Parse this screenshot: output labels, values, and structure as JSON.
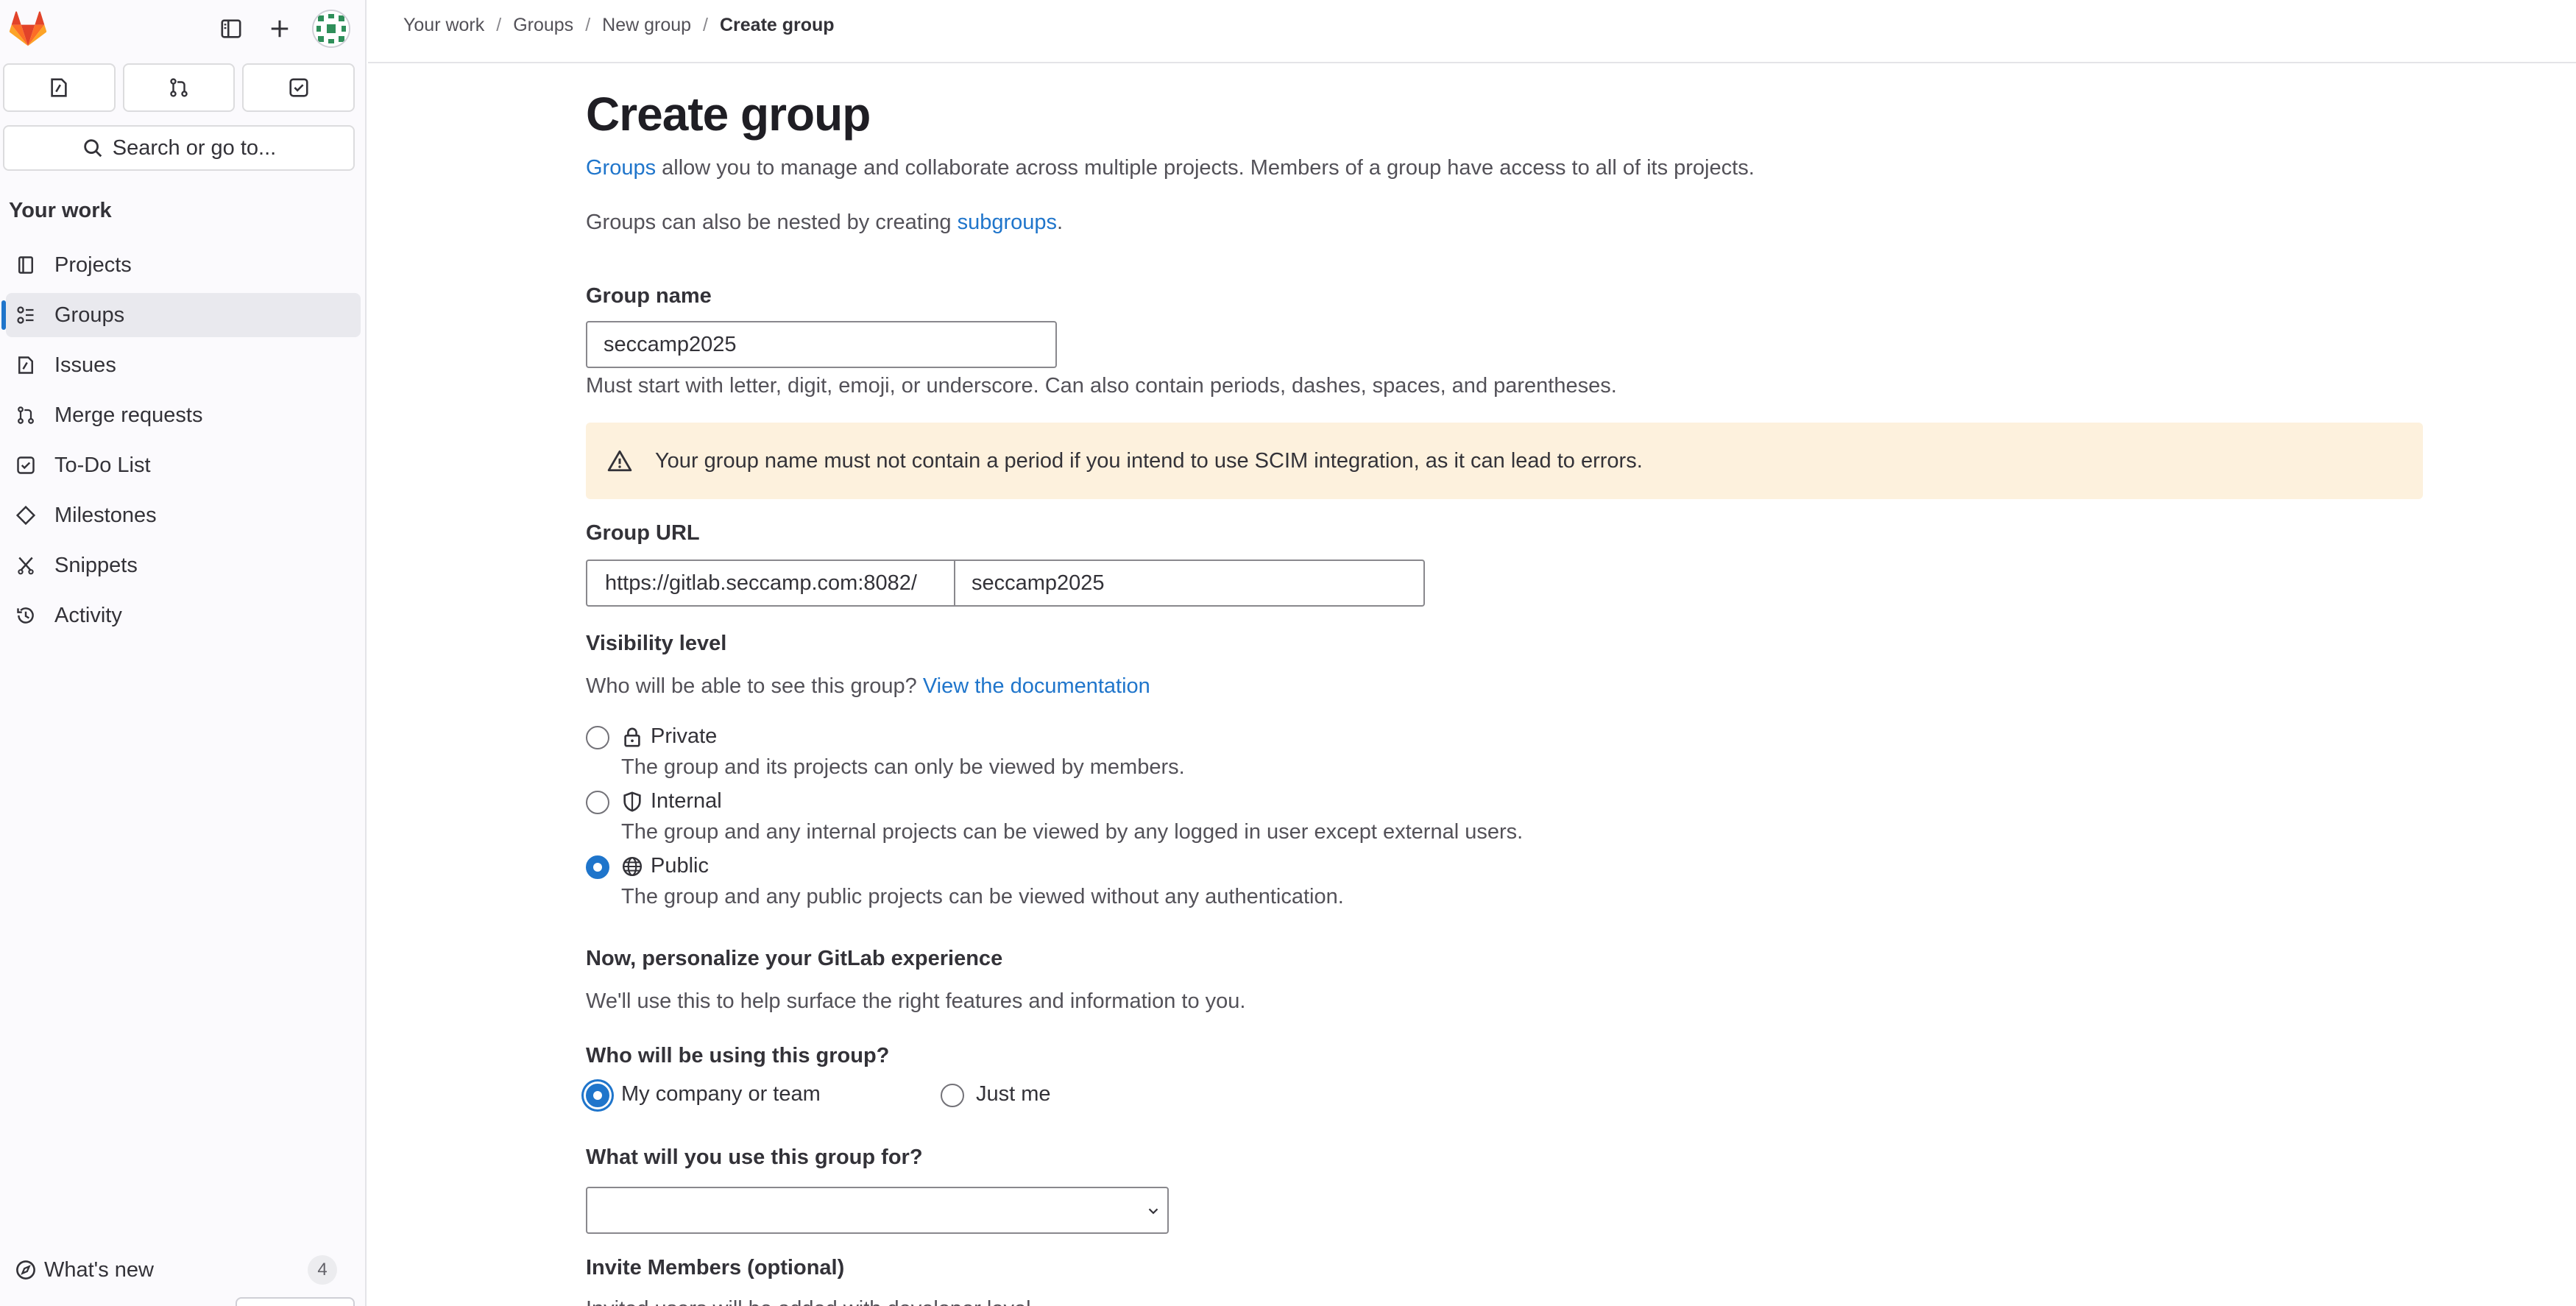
{
  "sidebar": {
    "search_label": "Search or go to...",
    "section_title": "Your work",
    "items": [
      {
        "label": "Projects",
        "icon": "project-icon"
      },
      {
        "label": "Groups",
        "icon": "group-icon"
      },
      {
        "label": "Issues",
        "icon": "issues-icon"
      },
      {
        "label": "Merge requests",
        "icon": "merge-request-icon"
      },
      {
        "label": "To-Do List",
        "icon": "todo-icon"
      },
      {
        "label": "Milestones",
        "icon": "milestone-icon"
      },
      {
        "label": "Snippets",
        "icon": "snippet-icon"
      },
      {
        "label": "Activity",
        "icon": "history-icon"
      }
    ],
    "active_item": "Groups",
    "whats_new_label": "What's new",
    "whats_new_count": "4"
  },
  "breadcrumb": {
    "items": [
      "Your work",
      "Groups",
      "New group"
    ],
    "current": "Create group"
  },
  "page": {
    "title": "Create group",
    "intro_link": "Groups",
    "intro_text": " allow you to manage and collaborate across multiple projects. Members of a group have access to all of its projects.",
    "nested_text": "Groups can also be nested by creating ",
    "nested_link": "subgroups",
    "nested_end": "."
  },
  "group_name": {
    "label": "Group name",
    "value": "seccamp2025",
    "help": "Must start with letter, digit, emoji, or underscore. Can also contain periods, dashes, spaces, and parentheses."
  },
  "warning": {
    "text": "Your group name must not contain a period if you intend to use SCIM integration, as it can lead to errors.",
    "color": "#fdf1dd"
  },
  "group_url": {
    "label": "Group URL",
    "prefix": "https://gitlab.seccamp.com:8082/",
    "value": "seccamp2025"
  },
  "visibility": {
    "label": "Visibility level",
    "question": "Who will be able to see this group? ",
    "doc_link": "View the documentation",
    "options": [
      {
        "label": "Private",
        "desc": "The group and its projects can only be viewed by members.",
        "icon": "lock-icon",
        "checked": false
      },
      {
        "label": "Internal",
        "desc": "The group and any internal projects can be viewed by any logged in user except external users.",
        "icon": "shield-icon",
        "checked": false
      },
      {
        "label": "Public",
        "desc": "The group and any public projects can be viewed without any authentication.",
        "icon": "earth-icon",
        "checked": true
      }
    ]
  },
  "personalize": {
    "title": "Now, personalize your GitLab experience",
    "desc": "We'll use this to help surface the right features and information to you.",
    "who_label": "Who will be using this group?",
    "who_options": [
      {
        "label": "My company or team",
        "checked": true
      },
      {
        "label": "Just me",
        "checked": false
      }
    ],
    "use_label": "What will you use this group for?",
    "use_value": ""
  },
  "invite": {
    "title": "Invite Members (optional)",
    "desc": "Invited users will be added with developer level"
  },
  "colors": {
    "accent": "#1f75cb",
    "link": "#1f75cb",
    "warning_bg": "#fdf1dd"
  }
}
